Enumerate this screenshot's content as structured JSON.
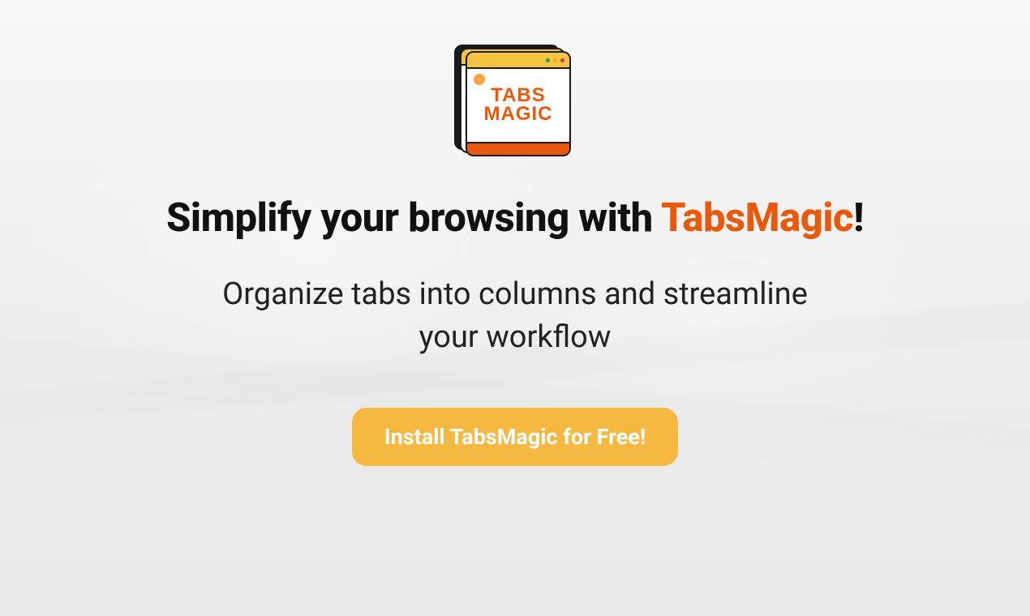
{
  "logo": {
    "line1": "TABS",
    "line2": "MAGIC"
  },
  "heading": {
    "prefix": "Simplify your browsing with ",
    "brand": "TabsMagic",
    "suffix": "!"
  },
  "subheading": "Organize tabs into columns and streamline your workflow",
  "cta": {
    "label": "Install TabsMagic for Free!"
  },
  "colors": {
    "accent": "#e8590c",
    "button": "#f5b942"
  }
}
